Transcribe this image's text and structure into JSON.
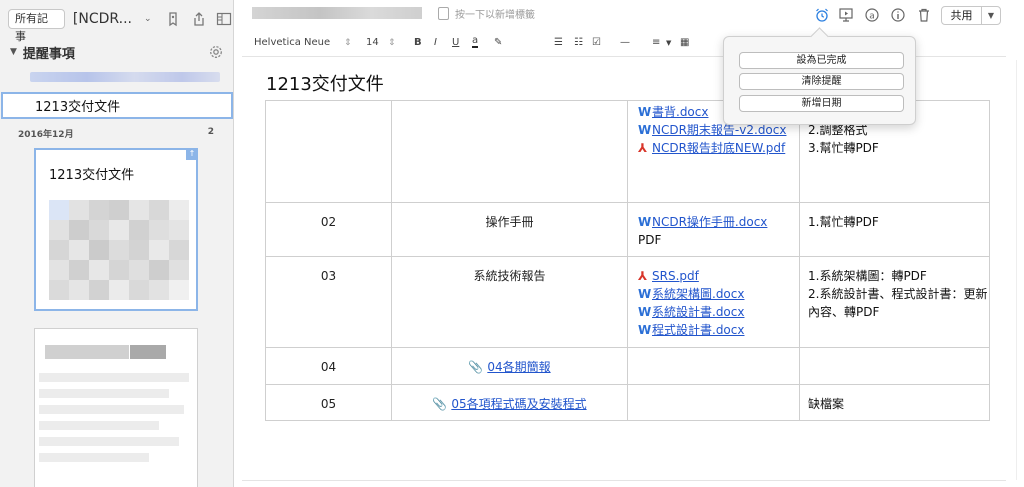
{
  "left": {
    "all_notes_label": "所有記事",
    "notebook_name": "[NCDR...",
    "reminders_title": "提醒事項",
    "selected_reminder": "1213交付文件",
    "month_label": "2016年12月",
    "month_count": "2",
    "card1_title": "1213交付文件"
  },
  "topbar": {
    "tag_hint": "按一下以新增標籤",
    "share_label": "共用",
    "icons": [
      "alarm-icon",
      "presentation-icon",
      "at-icon",
      "info-icon",
      "trash-icon"
    ]
  },
  "format_bar": {
    "font": "Helvetica Neue",
    "size": "14",
    "bold": "B",
    "italic": "I",
    "underline": "U",
    "color_a": "a"
  },
  "note": {
    "title": "1213交付文件",
    "rows": [
      {
        "num": "",
        "name": "",
        "files": [
          {
            "type": "w",
            "name": "書背.docx"
          },
          {
            "type": "w",
            "name": "NCDR期末報告-v2.docx"
          },
          {
            "type": "p",
            "name": "NCDR報告封底NEW.pdf"
          }
        ],
        "extra": "",
        "notes": [
          "2.調整格式",
          "3.幫忙轉PDF"
        ]
      },
      {
        "num": "02",
        "name": "操作手冊",
        "files": [
          {
            "type": "w",
            "name": "NCDR操作手冊.docx"
          }
        ],
        "extra": "PDF",
        "notes": [
          "1.幫忙轉PDF"
        ]
      },
      {
        "num": "03",
        "name": "系統技術報告",
        "files": [
          {
            "type": "p",
            "name": "SRS.pdf"
          },
          {
            "type": "w",
            "name": "系統架構圖.docx"
          },
          {
            "type": "w",
            "name": "系統設計書.docx"
          },
          {
            "type": "w",
            "name": "程式設計書.docx"
          }
        ],
        "extra": "",
        "notes": [
          "1.系統架構圖：轉PDF",
          "2.系統設計書、程式設計書：更新內容、轉PDF"
        ]
      },
      {
        "num": "04",
        "name_link": "04各期簡報",
        "files": [],
        "extra": "",
        "notes": []
      },
      {
        "num": "05",
        "name_link": "05各項程式碼及安裝程式",
        "files": [],
        "extra": "",
        "notes": [
          "缺檔案"
        ]
      }
    ]
  },
  "popover": {
    "mark_done": "設為已完成",
    "clear_reminder": "清除提醒",
    "add_date": "新增日期"
  },
  "colors": {
    "accent": "#2a7fe0",
    "link": "#2255cc",
    "word_icon": "#2b6fd6",
    "pdf_icon": "#d8352a",
    "selection_border": "#8cb5e8"
  }
}
